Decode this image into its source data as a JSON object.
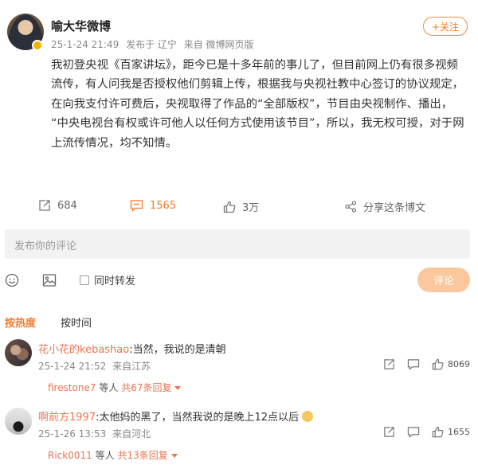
{
  "post": {
    "author": "喻大华微博",
    "timestamp": "25-1-24 21:49",
    "location": "发布于 辽宁",
    "source": "来自 微博网页版",
    "follow_label": "+关注",
    "text_lines": [
      "我初登央视《百家讲坛》，距今已是十多年前的事儿了，但目前网上仍有很多视频",
      "流传，有人问我是否授权他们剪辑上传，根据我与央视社教中心签订的协议规定，",
      "在向我支付许可费后，央视取得了作品的“全部版权”，节目由央视制作、播出，",
      "“中央电视台有权或许可他人以任何方式使用该节目”，所以，我无权可授，对于网",
      "上流传情况，均不知情。"
    ]
  },
  "actions": {
    "repost_count": "684",
    "comment_count": "1565",
    "like_count": "3万",
    "share_label": "分享这条博文"
  },
  "comment_box": {
    "placeholder": "发布你的评论",
    "repost_label": "同时转发",
    "submit_label": "评论"
  },
  "sort": {
    "hot_label": "按热度",
    "time_label": "按时间"
  },
  "comments": [
    {
      "user": "花小花的kebashao",
      "text": ":当然，我说的是清朝",
      "timestamp": "25-1-24 21:52",
      "location": "来自江苏",
      "like_count": "8069",
      "reply_user": "firestone7",
      "reply_mid": "等人",
      "reply_link": "共67条回复"
    },
    {
      "user": "啊前方1997",
      "text": ":太他妈的黑了，当然我说的是晚上12点以后",
      "timestamp": "25-1-26 13:53",
      "location": "来自河北",
      "like_count": "1655",
      "reply_user": "Rick0011",
      "reply_mid": "等人",
      "reply_link": "共13条回复"
    }
  ],
  "colors": {
    "accent": "#f47a2c",
    "name_link": "#eb7350",
    "comment_blue": "#4a90d9",
    "badge": "#f4b400"
  },
  "icons": [
    "repost-icon",
    "comment-icon",
    "like-icon",
    "share-icon",
    "emoji-icon",
    "image-icon",
    "caret-down-icon",
    "reply-icon"
  ]
}
